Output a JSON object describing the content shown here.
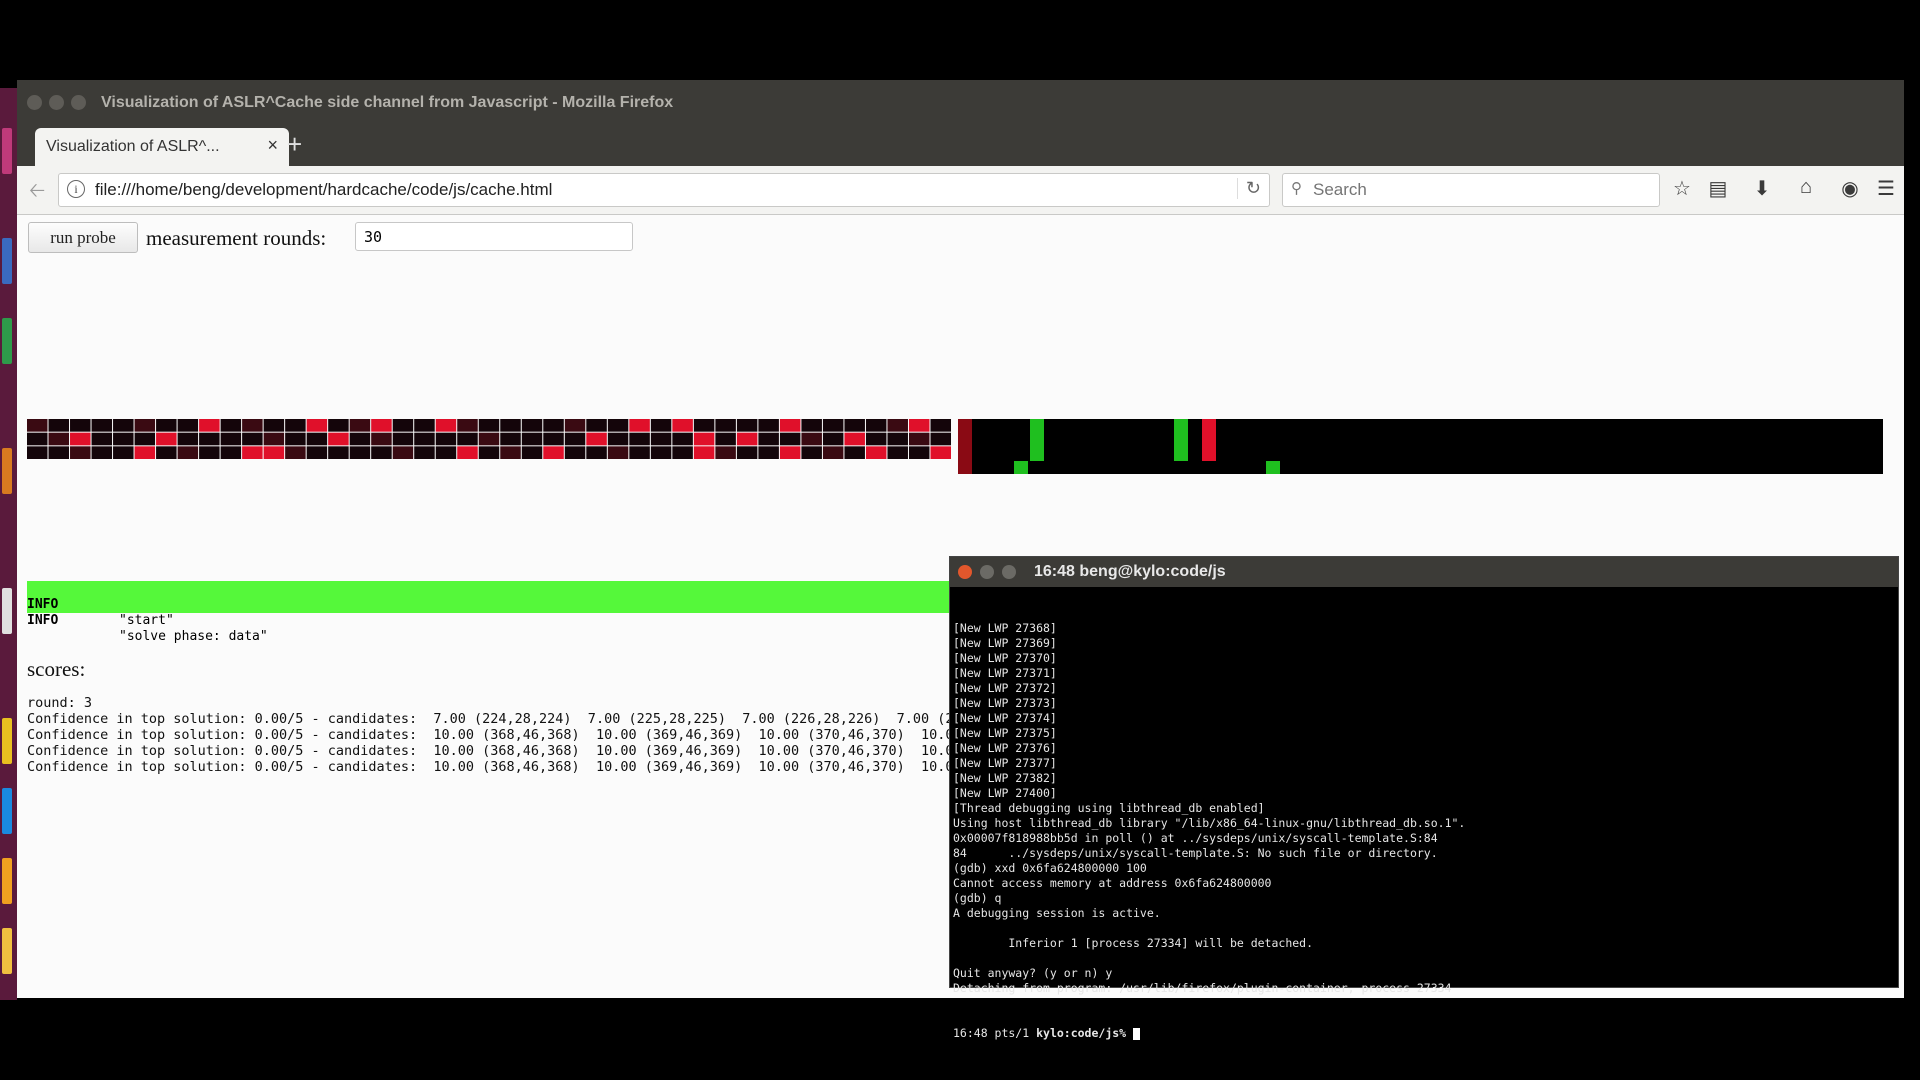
{
  "window": {
    "title": "Visualization of ASLR^Cache side channel from Javascript - Mozilla Firefox"
  },
  "tabs": [
    {
      "label": "Visualization of ASLR^...",
      "close_label": "×"
    }
  ],
  "new_tab_label": "+",
  "navbar": {
    "url": "file:///home/beng/development/hardcache/code/js/cache.html",
    "search_placeholder": "Search"
  },
  "toolbar_icons": [
    "back-icon",
    "info-icon",
    "reload-icon",
    "search-icon",
    "bookmark-star-icon",
    "reading-list-icon",
    "download-icon",
    "home-icon",
    "pocket-icon",
    "menu-icon"
  ],
  "controls": {
    "run_probe_label": "run probe",
    "rounds_label": "measurement rounds:",
    "rounds_value": "30"
  },
  "log": [
    {
      "level": "INFO",
      "message": "\"start\""
    },
    {
      "level": "INFO",
      "message": "\"solve phase: data\""
    }
  ],
  "scores": {
    "title": "scores:",
    "round": "round: 3",
    "lines": [
      "Confidence in top solution: 0.00/5 - candidates:  7.00 (224,28,224)  7.00 (225,28,225)  7.00 (226,28,226)  7.00 (2",
      "Confidence in top solution: 0.00/5 - candidates:  10.00 (368,46,368)  10.00 (369,46,369)  10.00 (370,46,370)  10.0",
      "Confidence in top solution: 0.00/5 - candidates:  10.00 (368,46,368)  10.00 (369,46,369)  10.00 (370,46,370)  10.0",
      "Confidence in top solution: 0.00/5 - candidates:  10.00 (368,46,368)  10.00 (369,46,369)  10.00 (370,46,370)  10.0"
    ]
  },
  "colors": {
    "log_bg": "#55f83a",
    "heat_red": "#e0102a",
    "heat_green": "#1fbf1f",
    "terminal_bg": "#000000",
    "titlebar_bg": "#3c3b37"
  },
  "terminal": {
    "title": "16:48 beng@kylo:code/js",
    "lines": [
      "[New LWP 27368]",
      "[New LWP 27369]",
      "[New LWP 27370]",
      "[New LWP 27371]",
      "[New LWP 27372]",
      "[New LWP 27373]",
      "[New LWP 27374]",
      "[New LWP 27375]",
      "[New LWP 27376]",
      "[New LWP 27377]",
      "[New LWP 27382]",
      "[New LWP 27400]",
      "[Thread debugging using libthread_db enabled]",
      "Using host libthread_db library \"/lib/x86_64-linux-gnu/libthread_db.so.1\".",
      "0x00007f818988bb5d in poll () at ../sysdeps/unix/syscall-template.S:84",
      "84      ../sysdeps/unix/syscall-template.S: No such file or directory.",
      "(gdb) xxd 0x6fa624800000 100",
      "Cannot access memory at address 0x6fa624800000",
      "(gdb) q",
      "A debugging session is active.",
      "",
      "        Inferior 1 [process 27334] will be detached.",
      "",
      "Quit anyway? (y or n) y",
      "Detaching from program: /usr/lib/firefox/plugin-container, process 27334"
    ],
    "prompt_prefix": "16:48 pts/1 ",
    "prompt_host": "kylo:code/js%"
  }
}
